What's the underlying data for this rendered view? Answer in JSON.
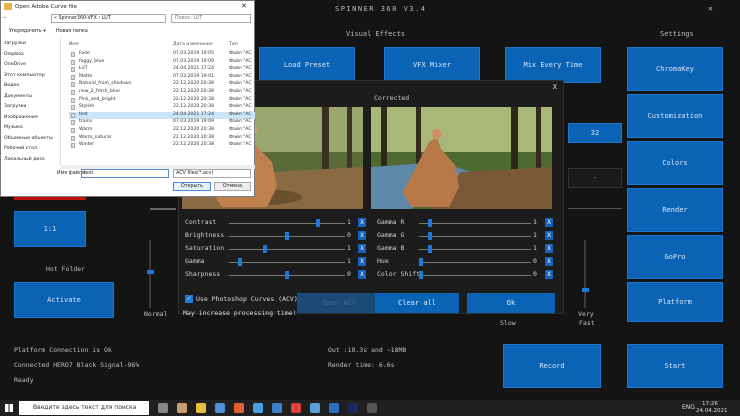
{
  "app": {
    "title": "SPINNER 360 V3.4",
    "headers": {
      "visual_effects": "Visual Effects",
      "settings": "Settings"
    },
    "buttons": {
      "load_preset": "Load Preset",
      "vfx_mixer": "VFX Mixer",
      "mix_every_time": "Mix Every Time",
      "chromakey": "ChromaKey",
      "customization": "Customization",
      "colors": "Colors",
      "render": "Render",
      "gopro": "GoPro",
      "platform": "Platform",
      "record": "Record",
      "start": "Start",
      "ratio": "1:1",
      "activate": "Activate",
      "small_value": "32"
    },
    "labels": {
      "hot_folder": "Hot Folder",
      "normal": "Normal",
      "very_fast_1": "Very",
      "very_fast_2": "Fast",
      "slow": "Slow"
    },
    "status": {
      "platform": "Platform Connection is Ok",
      "camera": "Connected HERO7 Black Signal-96%",
      "ready": "Ready",
      "out": "Out :18.3s and ~18MB",
      "render_time": "Render time: 6.6s"
    }
  },
  "effects_dialog": {
    "close": "X",
    "corrected_label": "Corrected",
    "left_sliders": [
      {
        "label": "Contrast",
        "value": "1",
        "pos": 0.78
      },
      {
        "label": "Brightness",
        "value": "0",
        "pos": 0.5
      },
      {
        "label": "Saturation",
        "value": "1",
        "pos": 0.3
      },
      {
        "label": "Gamma",
        "value": "1",
        "pos": 0.08
      },
      {
        "label": "Sharpness",
        "value": "0",
        "pos": 0.5
      }
    ],
    "right_sliders": [
      {
        "label": "Gamma R",
        "value": "1",
        "pos": 0.08
      },
      {
        "label": "Gamma G",
        "value": "1",
        "pos": 0.08
      },
      {
        "label": "Gamma B",
        "value": "1",
        "pos": 0.08
      },
      {
        "label": "Hue",
        "value": "0",
        "pos": 0.0
      },
      {
        "label": "Color Shift",
        "value": "0",
        "pos": 0.0
      }
    ],
    "remove_icon": "X",
    "checkbox_label": "Use Photoshop Curves (ACV)",
    "note": "May increase processing time!",
    "open_acv": "Open ACV",
    "clear_all": "Clear all",
    "ok": "Ok"
  },
  "file_dialog": {
    "title": "Open Adobe Curve file",
    "breadcrumb": "« Spinner360-VFX › LUT",
    "search_placeholder": "Поиск: LUT",
    "organize": "Упорядочить ▾",
    "new_folder": "Новая папка",
    "col_name": "Имя",
    "col_date": "Дата изменения",
    "col_type": "Тип",
    "nav": [
      "загрузки",
      "Dropbox",
      "OneDrive",
      "Этот компьютер",
      "Видео",
      "Документы",
      "Загрузки",
      "Изображения",
      "Музыка",
      "Объемные объекты",
      "Рабочий стол",
      "Локальный диск"
    ],
    "files": [
      {
        "name": "Fade",
        "date": "07.03.2019 19:05",
        "type": "Файл \"AC"
      },
      {
        "name": "foggy_blue",
        "date": "07.03.2019 19:09",
        "type": "Файл \"AC"
      },
      {
        "name": "LUT",
        "date": "24.04.2021 17:24",
        "type": "Файл \"AC"
      },
      {
        "name": "Matte",
        "date": "07.03.2019 19:01",
        "type": "Файл \"AC"
      },
      {
        "name": "Natural_from_shadows",
        "date": "22.12.2020 20:38",
        "type": "Файл \"AC"
      },
      {
        "name": "new_2_fresh_blue",
        "date": "22.12.2020 20:38",
        "type": "Файл \"AC"
      },
      {
        "name": "Pink_and_bright",
        "date": "22.12.2020 20:38",
        "type": "Файл \"AC"
      },
      {
        "name": "Stylish",
        "date": "22.12.2020 20:38",
        "type": "Файл \"AC"
      },
      {
        "name": "test",
        "date": "24.04.2021 17:24",
        "type": "Файл \"AC"
      },
      {
        "name": "trains",
        "date": "07.03.2019 19:09",
        "type": "Файл \"AC"
      },
      {
        "name": "Warm",
        "date": "22.12.2020 20:38",
        "type": "Файл \"AC"
      },
      {
        "name": "Warm_natural",
        "date": "22.12.2020 20:38",
        "type": "Файл \"AC"
      },
      {
        "name": "Winter",
        "date": "22.12.2020 20:38",
        "type": "Файл \"AC"
      }
    ],
    "filename_label": "Имя файла:",
    "filename_value": "test",
    "filter": "ACV files(*.acv)",
    "open": "Открыть",
    "cancel": "Отмена"
  },
  "taskbar": {
    "search_placeholder": "Введите здесь текст для поиска",
    "lang": "ENG",
    "time": "17:26",
    "date": "24.04.2021"
  },
  "colors": {
    "accent": "#0b63b5",
    "button_border": "#1a76cf",
    "bg": "#141414",
    "red_button": "#c01010"
  }
}
